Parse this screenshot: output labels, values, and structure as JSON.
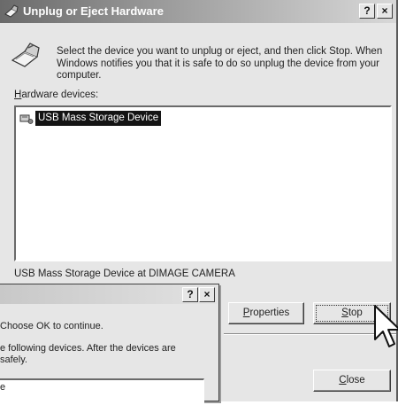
{
  "window": {
    "title": "Unplug or Eject Hardware",
    "help_btn": "?",
    "close_btn": "×"
  },
  "description": "Select the device you want to unplug or eject, and then click Stop. When Windows notifies you that it is safe to do so unplug the device from your computer.",
  "hardware_label": {
    "underlined": "H",
    "rest": "ardware devices:"
  },
  "devices": [
    {
      "label": "USB Mass Storage Device",
      "icon": "usb-device-icon",
      "selected": true
    }
  ],
  "status_text": "USB Mass Storage Device at DIMAGE CAMERA",
  "buttons": {
    "properties": {
      "underlined": "P",
      "rest": "roperties"
    },
    "stop": {
      "underlined": "S",
      "rest": "top"
    },
    "close": {
      "underlined": "C",
      "rest": "lose"
    }
  },
  "dialog2": {
    "help_btn": "?",
    "close_btn": "×",
    "line1": "Choose OK to continue.",
    "line2a": "e following devices. After the devices are",
    "line2b": "safely.",
    "list_item": "e"
  },
  "colors": {
    "selection": "#141414",
    "face": "#e6e6e6"
  }
}
